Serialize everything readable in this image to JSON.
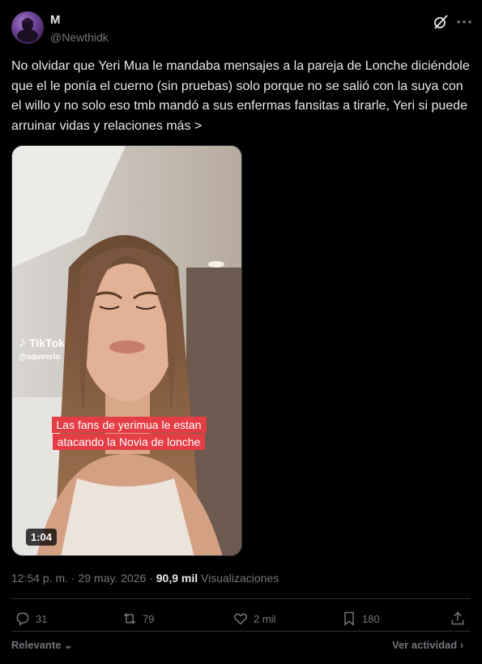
{
  "author": {
    "name": "M",
    "handle": "@Newthidk"
  },
  "tweet": {
    "text": "No olvidar que Yeri Mua le mandaba mensajes a la pareja de Lonche diciéndole que el le ponía el cuerno (sin pruebas) solo porque no se salió con la suya con el willo y no solo eso tmb mandó a sus enfermas fansitas a tirarle, Yeri si puede arruinar vidas y relaciones más >"
  },
  "media": {
    "tiktok_brand": "TikTok",
    "tiktok_user": "@aquverlo",
    "caption_line1": "Las fans de yerimua le estan",
    "caption_line2": "atacando la Novia de lonche",
    "duration": "1:04"
  },
  "meta": {
    "time": "12:54 p. m.",
    "separator": "·",
    "date": "29 may. 2026",
    "views_count": "90,9 mil",
    "views_label": "Visualizaciones"
  },
  "actions": {
    "replies": "31",
    "reposts": "79",
    "likes": "2 mil",
    "bookmarks": "180"
  },
  "footer": {
    "sort_label": "Relevante",
    "activity_label": "Ver actividad"
  },
  "colors": {
    "background": "#000000",
    "text": "#e7e9ea",
    "muted": "#71767b",
    "border": "#2f3336",
    "caption_bg": "#e43d46"
  },
  "icons": [
    "grok-icon",
    "more-icon",
    "reply-icon",
    "repost-icon",
    "like-icon",
    "bookmark-icon",
    "share-icon",
    "chevron-down-icon",
    "chevron-right-icon",
    "tiktok-note-icon"
  ]
}
